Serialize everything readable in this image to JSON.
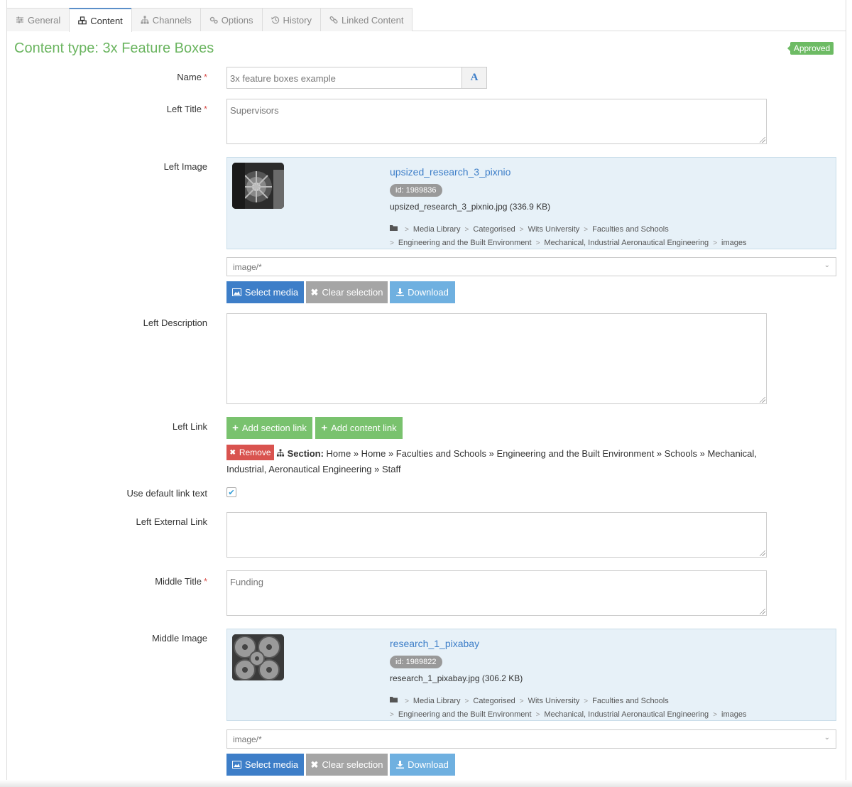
{
  "tabs": [
    {
      "label": "General",
      "icon": "sliders-icon"
    },
    {
      "label": "Content",
      "icon": "cubes-icon"
    },
    {
      "label": "Channels",
      "icon": "sitemap-icon"
    },
    {
      "label": "Options",
      "icon": "cogs-icon"
    },
    {
      "label": "History",
      "icon": "history-icon"
    },
    {
      "label": "Linked Content",
      "icon": "link-icon"
    }
  ],
  "active_tab": "Content",
  "content_type": "Content type: 3x Feature Boxes",
  "status_badge": "Approved",
  "fields": {
    "name": {
      "label": "Name",
      "required": "*",
      "value": "3x feature boxes example",
      "font_button": "A"
    },
    "left_title": {
      "label": "Left Title",
      "required": "*",
      "value": "Supervisors"
    },
    "left_image": {
      "label": "Left Image"
    },
    "left_description": {
      "label": "Left Description",
      "value": ""
    },
    "left_link": {
      "label": "Left Link"
    },
    "use_default_link_text": {
      "label": "Use default link text",
      "checked": true
    },
    "left_external_link": {
      "label": "Left External Link",
      "value": ""
    },
    "middle_title": {
      "label": "Middle Title",
      "required": "*",
      "value": "Funding"
    },
    "middle_image": {
      "label": "Middle Image"
    }
  },
  "media_left": {
    "title": "upsized_research_3_pixnio",
    "id": "id: 1989836",
    "file": "upsized_research_3_pixnio.jpg (336.9 KB)",
    "path": [
      "Media Library",
      "Categorised",
      "Wits University",
      "Faculties and Schools",
      "Engineering and the Built Environment",
      "Mechanical, Industrial Aeronautical Engineering",
      "images"
    ]
  },
  "media_middle": {
    "title": "research_1_pixabay",
    "id": "id: 1989822",
    "file": "research_1_pixabay.jpg (306.2 KB)",
    "path": [
      "Media Library",
      "Categorised",
      "Wits University",
      "Faculties and Schools",
      "Engineering and the Built Environment",
      "Mechanical, Industrial Aeronautical Engineering",
      "images"
    ]
  },
  "mime_filter": "image/*",
  "buttons": {
    "select_media": "Select media",
    "clear_selection": "Clear selection",
    "download": "Download",
    "add_section_link": "Add section link",
    "add_content_link": "Add content link",
    "remove": "Remove"
  },
  "section_link": {
    "prefix": "Section:",
    "path": "Home » Home » Faculties and Schools » Engineering and the Built Environment » Schools » Mechanical, Industrial, Aeronautical Engineering » Staff"
  },
  "colors": {
    "accent_blue": "#3d7ec8",
    "success_green": "#6bb560",
    "danger_red": "#d9534f",
    "media_bg": "#e7f1f8"
  }
}
